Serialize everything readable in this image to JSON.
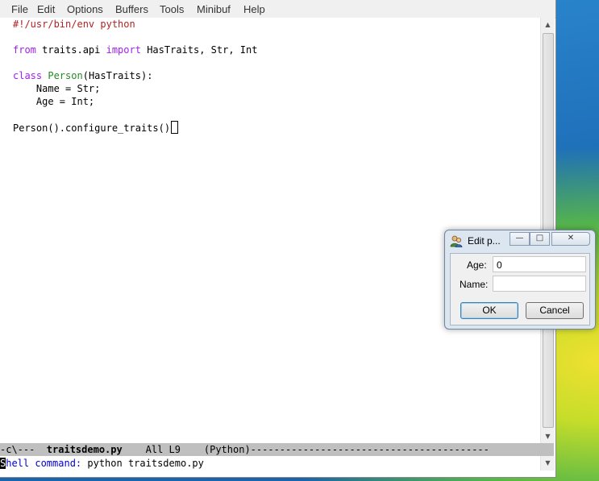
{
  "menubar": {
    "items": [
      "File",
      "Edit",
      "Options",
      "Buffers",
      "Tools",
      "Minibuf",
      "Help"
    ]
  },
  "editor": {
    "lines": {
      "l1": "#!/usr/bin/env python",
      "l3_kw1": "from",
      "l3_mid": " traits.api ",
      "l3_kw2": "import",
      "l3_rest": " HasTraits, Str, Int",
      "l5_kw": "class",
      "l5_name": "Person",
      "l5_rest": "(HasTraits):",
      "l6": "    Name = Str;",
      "l7": "    Age = Int;",
      "l9": "Person().configure_traits()"
    }
  },
  "modeline": {
    "prefix": "-c\\---  ",
    "buffer": "traitsdemo.py",
    "position": "    All L9    ",
    "mode": "(Python)",
    "fill": "-----------------------------------------"
  },
  "minibuffer": {
    "cursor_char": "S",
    "prompt": "hell command:",
    "value": " python traitsdemo.py"
  },
  "dialog": {
    "title": "Edit p...",
    "minimize": "—",
    "maximize": "□",
    "close": "✕",
    "age_label": "Age:",
    "age_value": "0",
    "name_label": "Name:",
    "name_value": "",
    "ok_label": "OK",
    "cancel_label": "Cancel"
  },
  "icons": {
    "scroll_up": "scroll-up-arrow-icon",
    "scroll_down": "scroll-down-arrow-icon",
    "dialog_app": "users-icon"
  }
}
